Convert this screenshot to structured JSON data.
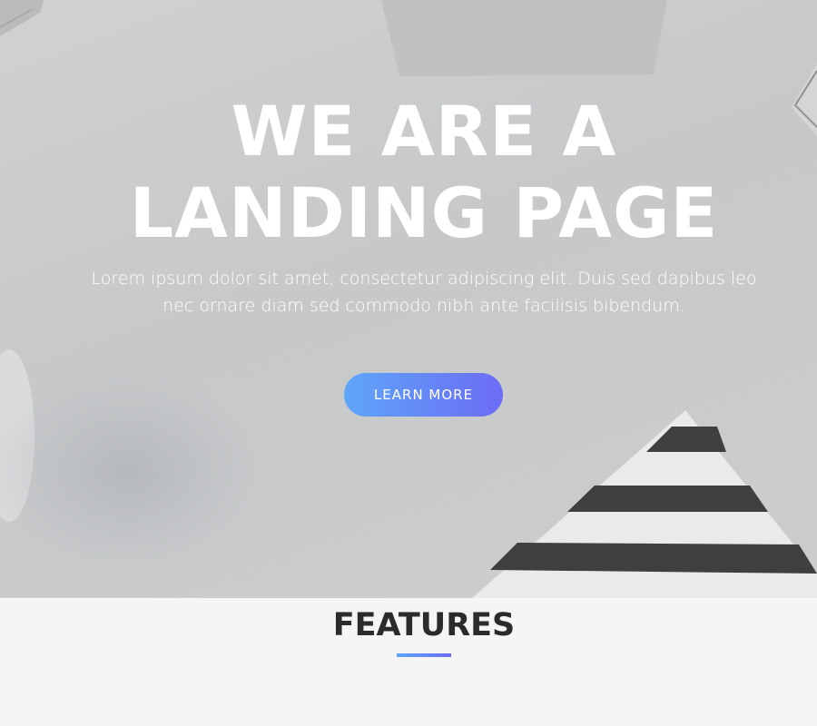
{
  "hero": {
    "title_line1": "WE ARE A",
    "title_line2": "LANDING PAGE",
    "subtitle": "Lorem ipsum dolor sit amet, consectetur adipiscing elit. Duis sed dapibus leo nec ornare diam sed commodo nibh ante facilisis bibendum.",
    "cta_label": "LEARN MORE"
  },
  "features": {
    "title": "FEATURES"
  },
  "colors": {
    "accent_start": "#5ea6f8",
    "accent_end": "#6c6cf6",
    "hero_bg": "#c9cbcd",
    "heading_dark": "#2b2b2b"
  }
}
